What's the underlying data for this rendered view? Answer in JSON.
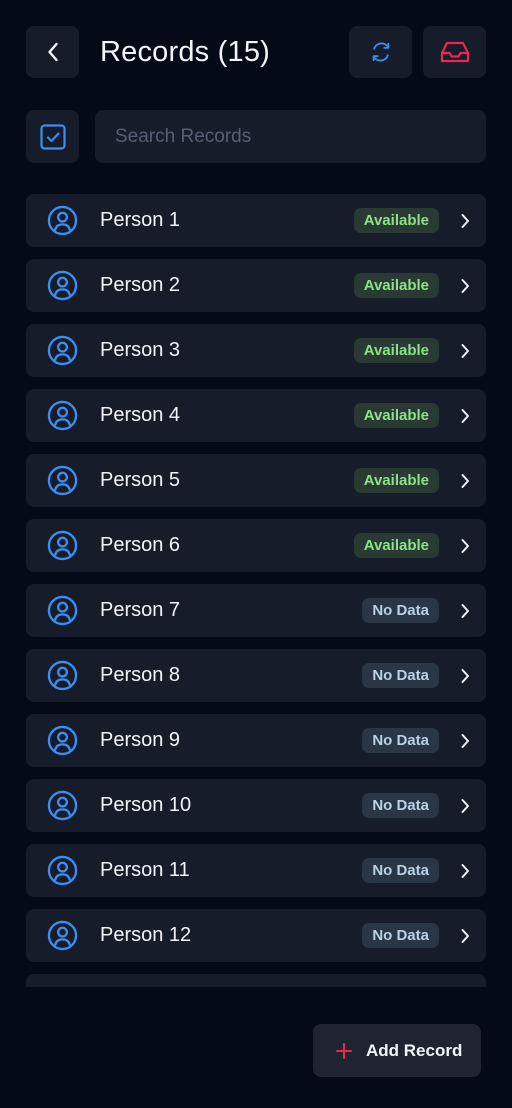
{
  "header": {
    "title": "Records (15)",
    "back_icon": "chevron-left-icon",
    "refresh_icon": "refresh-icon",
    "inbox_icon": "inbox-icon"
  },
  "search": {
    "placeholder": "Search Records",
    "value": ""
  },
  "colors": {
    "background": "#050a18",
    "surface": "#161c2a",
    "accent_blue": "#3b8ff0",
    "accent_red": "#e8294f",
    "available_text": "#8fe08a",
    "nodata_text": "#b9d2e6"
  },
  "records": [
    {
      "name": "Person 1",
      "status": "Available",
      "status_type": "available"
    },
    {
      "name": "Person 2",
      "status": "Available",
      "status_type": "available"
    },
    {
      "name": "Person 3",
      "status": "Available",
      "status_type": "available"
    },
    {
      "name": "Person 4",
      "status": "Available",
      "status_type": "available"
    },
    {
      "name": "Person 5",
      "status": "Available",
      "status_type": "available"
    },
    {
      "name": "Person 6",
      "status": "Available",
      "status_type": "available"
    },
    {
      "name": "Person 7",
      "status": "No Data",
      "status_type": "nodata"
    },
    {
      "name": "Person 8",
      "status": "No Data",
      "status_type": "nodata"
    },
    {
      "name": "Person 9",
      "status": "No Data",
      "status_type": "nodata"
    },
    {
      "name": "Person 10",
      "status": "No Data",
      "status_type": "nodata"
    },
    {
      "name": "Person 11",
      "status": "No Data",
      "status_type": "nodata"
    },
    {
      "name": "Person 12",
      "status": "No Data",
      "status_type": "nodata"
    }
  ],
  "footer": {
    "add_label": "Add Record",
    "add_icon": "plus-icon"
  }
}
